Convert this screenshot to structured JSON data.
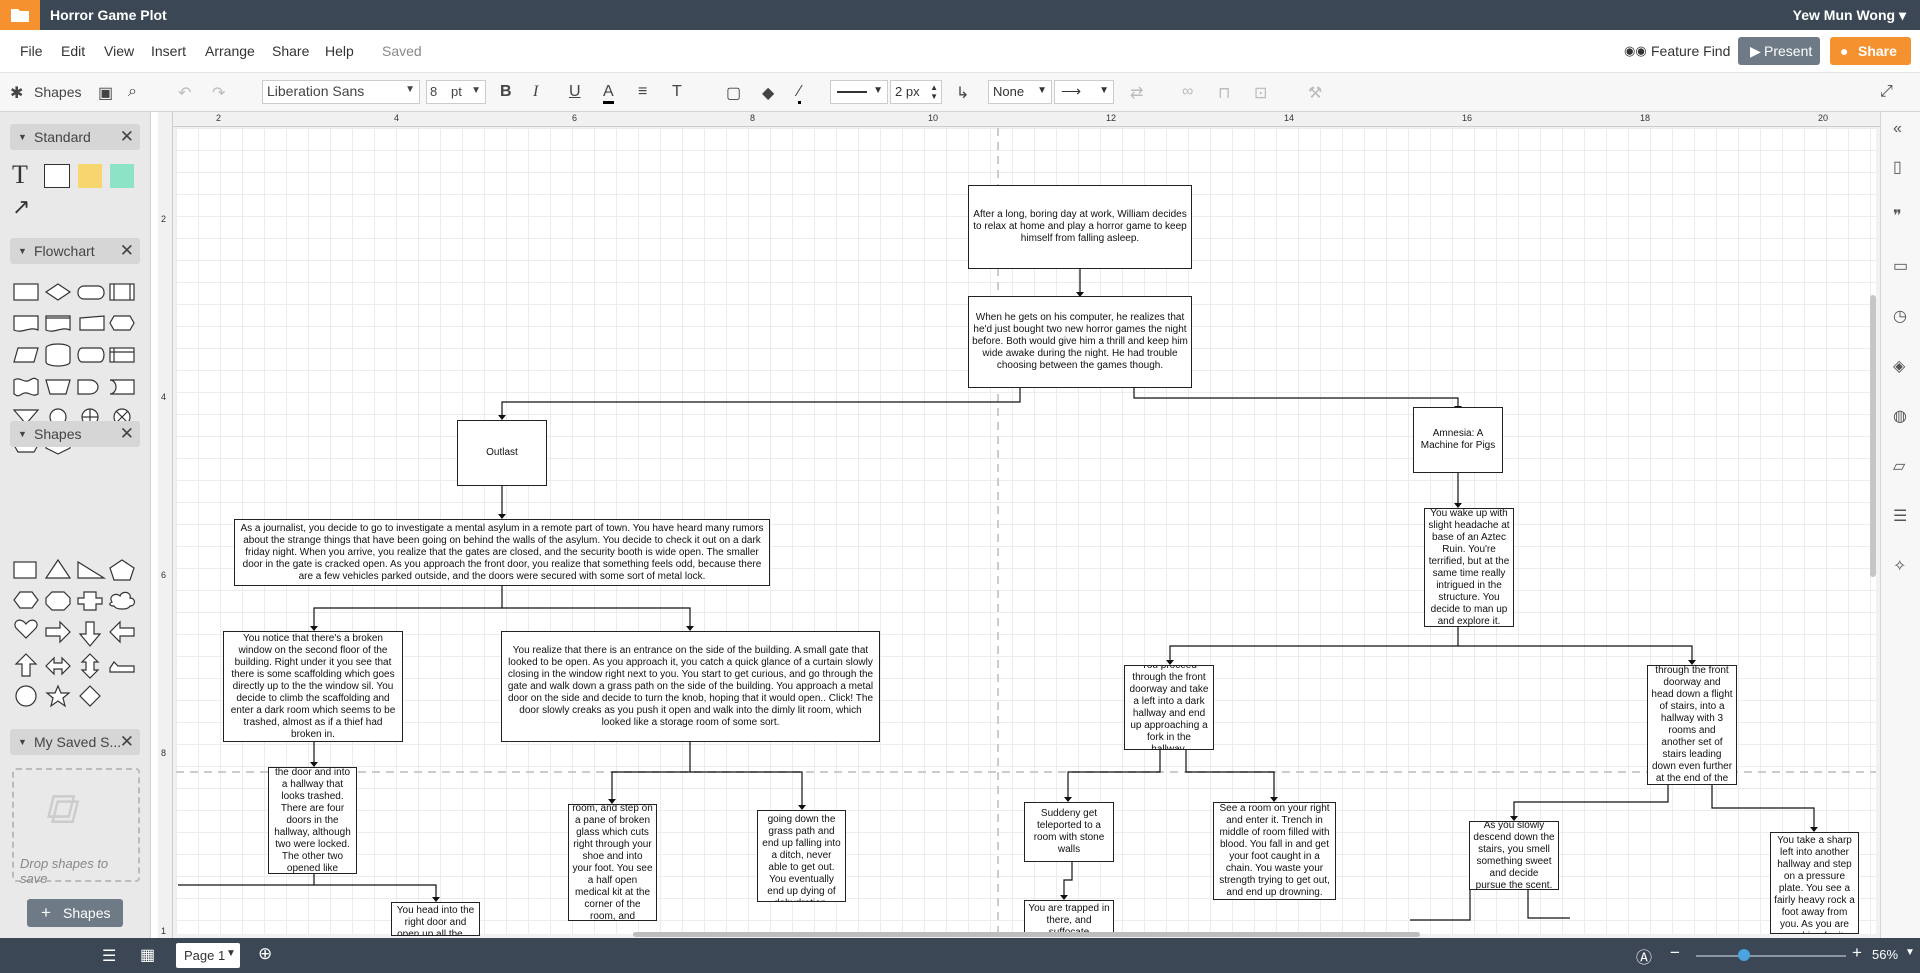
{
  "app": {
    "document_title": "Horror Game Plot",
    "user_name": "Yew Mun Wong"
  },
  "menu": {
    "items": [
      "File",
      "Edit",
      "View",
      "Insert",
      "Arrange",
      "Share",
      "Help"
    ],
    "status": "Saved",
    "feature_find": "Feature Find",
    "present": "Present",
    "share": "Share"
  },
  "toolbar": {
    "shapes_label": "Shapes",
    "font_family": "Liberation Sans",
    "font_size": "8",
    "font_unit": "pt",
    "line_width": "2 px",
    "endpoint_start": "None"
  },
  "sidebar": {
    "panels": [
      "Standard",
      "Flowchart",
      "Shapes",
      "My Saved S..."
    ],
    "drop_text": "Drop shapes to save",
    "add_shapes": "Shapes"
  },
  "rulers": {
    "top": [
      "2",
      "4",
      "6",
      "8",
      "10",
      "12",
      "14",
      "16",
      "18",
      "20"
    ],
    "left": [
      "2",
      "4",
      "6",
      "8",
      "1"
    ]
  },
  "diagram": {
    "nodes": [
      {
        "id": "n1",
        "text": "After a long, boring day at work, William decides to relax at home and play a horror game to keep himself from falling asleep."
      },
      {
        "id": "n2",
        "text": "When he gets on his computer, he realizes that he'd just bought two new horror games the night before. Both would give him a thrill and keep him wide awake during the night. He had trouble choosing between the games though."
      },
      {
        "id": "outlast",
        "text": "Outlast"
      },
      {
        "id": "amnesia",
        "text": "Amnesia: A Machine for Pigs"
      },
      {
        "id": "o1",
        "text": "As a  journalist, you decide to go to investigate a mental asylum in a remote part of town. You have heard many rumors about the strange things that have been going on behind the walls of the asylum. You decide to check it out on a dark friday night. When you arrive, you realize that the gates are closed, and the security booth is wide open. The smaller door in the gate is cracked open. As you approach the front door, you realize that something feels odd, because there are a few vehicles parked outside, and the doors were secured with some sort of metal lock."
      },
      {
        "id": "o2",
        "text": "You notice that there's a broken window on the second floor of the building. Right under it you see that there is some scaffolding which goes directly up to the the window sil. You decide to climb the scaffolding and enter a dark room which seems to be trashed, almost as if a thief had broken in."
      },
      {
        "id": "o3",
        "text": "You realize that there is an entrance on the side of the building. A small gate that looked to be open. As you approach it, you catch a quick glance of a curtain slowly closing in the window right next to you. You start to get curious, and go through the gate and walk down a grass path on the side of the building. You approach a metal door on the side and decide to turn the knob, hoping that it would open.. Click! The door slowly creaks as you push it open and walk into the dimly lit room, which looked like a storage room of some sort."
      },
      {
        "id": "o4",
        "text": "You walk out of the door and into a hallway that looks trashed. There are four doors in the hallway, although two were locked. The other two opened like butter."
      },
      {
        "id": "o5",
        "text": "You enter the room, and step on a  pane of broken glass which cuts right through your shoe and into your foot. You see a half open medical kit at the corner of the room, and proceed to it."
      },
      {
        "id": "o6",
        "text": "You continue going down the grass path and end up falling into a ditch, never able to get out. You eventually end up dying of dehydration."
      },
      {
        "id": "o7",
        "text": "You head into the right door and open up all the ..."
      },
      {
        "id": "a1",
        "text": "You wake up with slight headache at base of an Aztec Ruin. You're terrified, but at the same time really intrigued in the structure. You decide to man up and explore it."
      },
      {
        "id": "a2",
        "text": "You proceed through the front doorway and take a left into a dark hallway and end up approaching a fork in the hallway."
      },
      {
        "id": "a3",
        "text": "You proceed through the front doorway and head down a flight of stairs, into a hallway with 3 rooms and another set of stairs leading down even further at the end of the hallway."
      },
      {
        "id": "a4",
        "text": "Suddeny get teleported to a room with stone walls"
      },
      {
        "id": "a5",
        "text": "See a room on your right and enter it. Trench in middle of room filled with blood. You fall in and get your foot caught in a chain. You waste your strength trying to get out, and end up drowning."
      },
      {
        "id": "a6",
        "text": "As you slowly descend down the stairs, you smell something sweet and decide pursue the scent."
      },
      {
        "id": "a7",
        "text": "You take a sharp left into another hallway and step on a pressure plate. You see a fairly heavy rock a foot away from you. As you are reaching for it, boulder drops"
      },
      {
        "id": "a8",
        "text": "You are trapped in there, and suffocate"
      }
    ]
  },
  "bottom": {
    "page_tab": "Page 1",
    "zoom": "56%"
  }
}
